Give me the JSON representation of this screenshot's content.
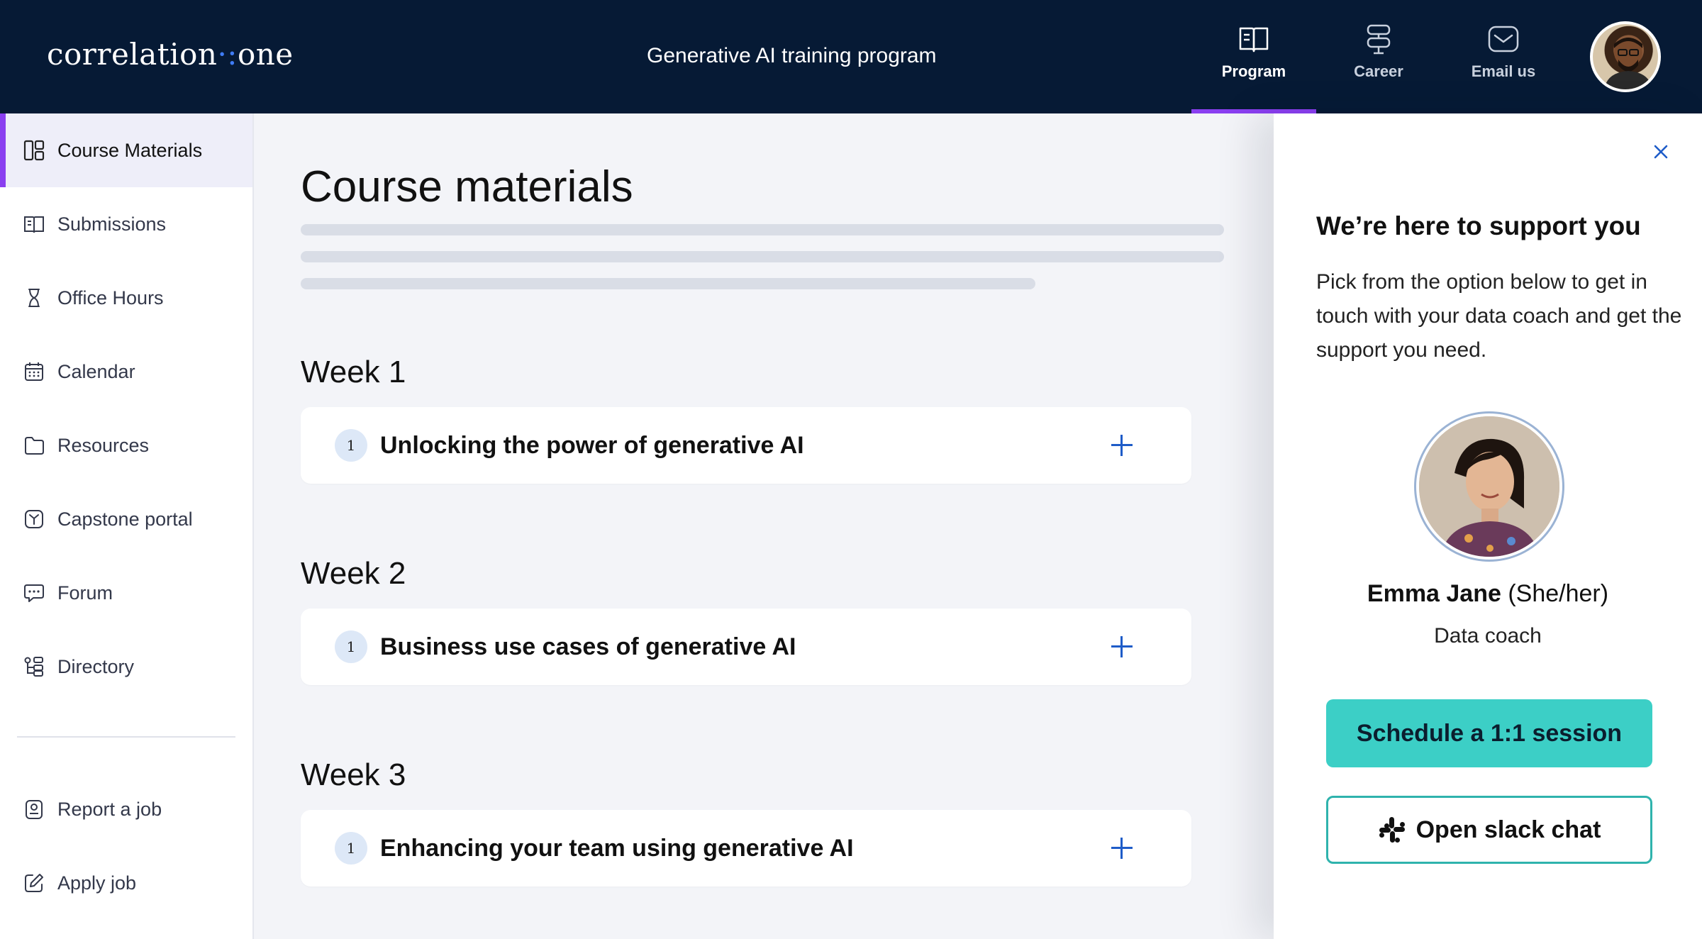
{
  "header": {
    "logo_main": "correlation",
    "logo_dots": "·:",
    "logo_tail": "one",
    "program_title": "Generative AI training program",
    "nav": [
      {
        "label": "Program",
        "icon": "book-icon",
        "active": true
      },
      {
        "label": "Career",
        "icon": "signpost-icon",
        "active": false
      },
      {
        "label": "Email us",
        "icon": "mail-icon",
        "active": false
      }
    ]
  },
  "sidebar": {
    "items": [
      {
        "label": "Course Materials",
        "icon": "layout-icon",
        "active": true
      },
      {
        "label": "Submissions",
        "icon": "book-open-icon"
      },
      {
        "label": "Office Hours",
        "icon": "hourglass-icon"
      },
      {
        "label": "Calendar",
        "icon": "calendar-icon"
      },
      {
        "label": "Resources",
        "icon": "folder-icon"
      },
      {
        "label": "Capstone portal",
        "icon": "capstone-icon"
      },
      {
        "label": "Forum",
        "icon": "chat-icon"
      },
      {
        "label": "Directory",
        "icon": "hierarchy-icon"
      }
    ],
    "bottom_items": [
      {
        "label": "Report a job",
        "icon": "badge-icon"
      },
      {
        "label": "Apply job",
        "icon": "edit-icon"
      }
    ]
  },
  "main": {
    "title": "Course materials",
    "weeks": [
      {
        "label": "Week 1",
        "module_number": "1",
        "module_title": "Unlocking the power of generative AI"
      },
      {
        "label": "Week 2",
        "module_number": "1",
        "module_title": "Business use cases of generative AI"
      },
      {
        "label": "Week 3",
        "module_number": "1",
        "module_title": "Enhancing your team using generative AI"
      }
    ]
  },
  "support_panel": {
    "title": "We’re here to support you",
    "body": "Pick from the option below to get in touch with your data coach and get the support you need.",
    "coach_name": "Emma Jane",
    "coach_pronouns": " (She/her)",
    "coach_role": "Data coach",
    "primary_button": "Schedule a 1:1 session",
    "secondary_button": "Open slack chat"
  },
  "colors": {
    "header_bg": "#061a35",
    "accent_purple": "#8a3ff0",
    "teal": "#3ccfc6",
    "plus_blue": "#1e5cc8"
  }
}
